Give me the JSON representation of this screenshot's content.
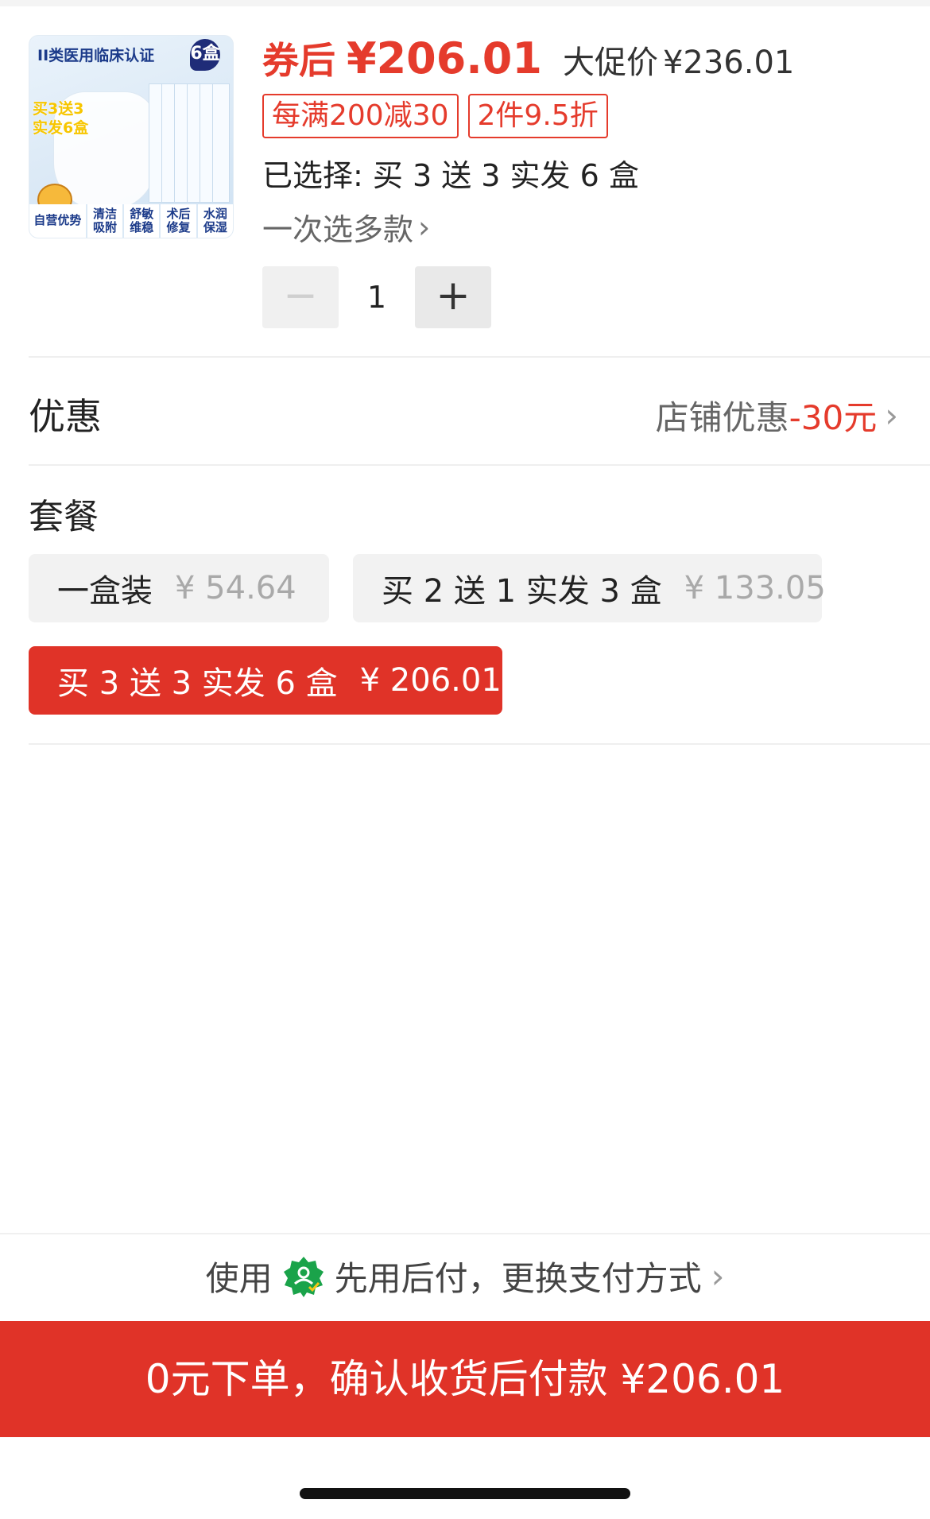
{
  "product": {
    "thumbnail": {
      "cert_text": "II类医用临床认证",
      "box_count": "6盒",
      "promo_line1": "买3送3",
      "promo_line2": "实发6盒",
      "features": [
        "自营优势",
        "清洁吸附",
        "舒敏维稳",
        "术后修复",
        "水润保湿"
      ]
    },
    "coupon_label": "券后",
    "coupon_price": "¥206.01",
    "orig_label": "大促价",
    "orig_price": "¥236.01",
    "promo_tags": [
      "每满200减30",
      "2件9.5折"
    ],
    "selected_text": "已选择: 买 3 送 3 实发 6 盒",
    "multi_select": "一次选多款",
    "quantity": "1",
    "minus_symbol": "−",
    "plus_symbol": "+"
  },
  "discount": {
    "title": "优惠",
    "store_label": "店铺优惠",
    "amount": "-30元"
  },
  "packages": {
    "title": "套餐",
    "options": [
      {
        "label": "一盒装",
        "price": "¥ 54.64",
        "selected": false
      },
      {
        "label": "买 2 送 1 实发 3 盒",
        "price": "¥ 133.05",
        "selected": false
      },
      {
        "label": "买 3 送 3 实发 6 盒",
        "price": "¥ 206.01",
        "selected": true
      }
    ]
  },
  "payment": {
    "use_label": "使用",
    "method_label": "先用后付，更换支付方式",
    "icon": "badge-check-icon"
  },
  "cta": {
    "label": "0元下单，确认收货后付款 ¥206.01"
  },
  "colors": {
    "accent": "#e53b2c",
    "cta_bg": "#e03328",
    "pay_icon": "#1aa34a"
  }
}
